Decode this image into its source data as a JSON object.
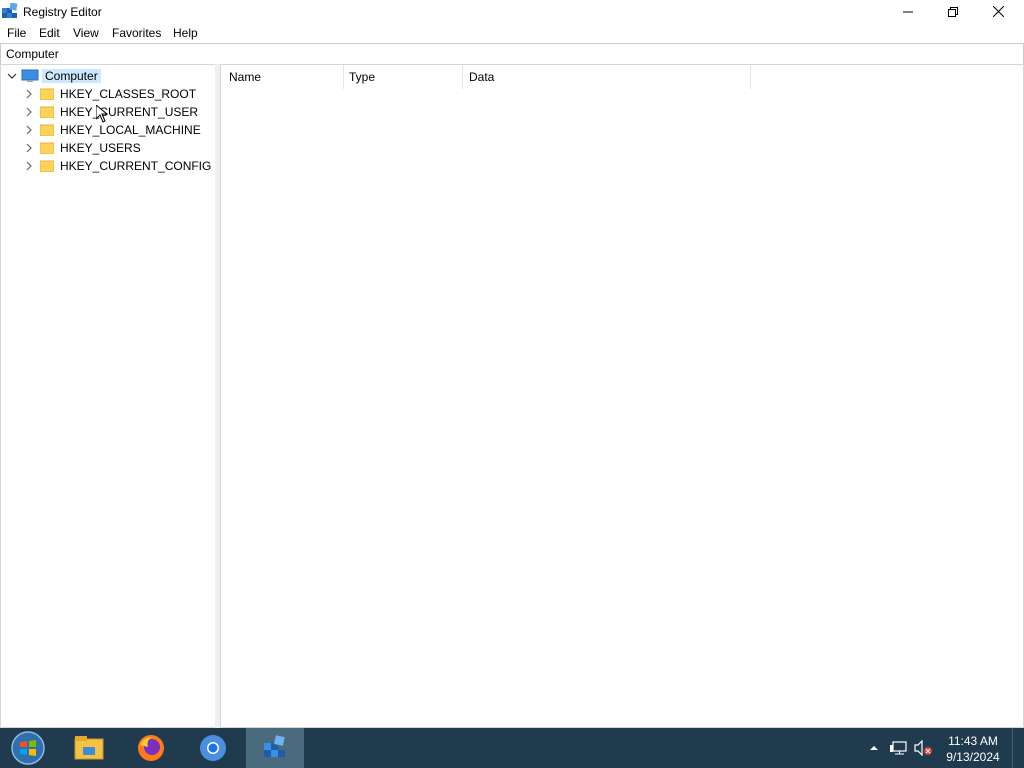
{
  "window": {
    "title": "Registry Editor",
    "controls": {
      "minimize_icon": "minimize-icon",
      "restore_icon": "restore-icon",
      "close_icon": "close-icon"
    }
  },
  "menu": {
    "items": [
      {
        "label": "File"
      },
      {
        "label": "Edit"
      },
      {
        "label": "View"
      },
      {
        "label": "Favorites"
      },
      {
        "label": "Help"
      }
    ]
  },
  "address": {
    "value": "Computer"
  },
  "tree": {
    "root": {
      "label": "Computer",
      "icon": "computer-icon",
      "expanded": true,
      "selected": true
    },
    "items": [
      {
        "label": "HKEY_CLASSES_ROOT",
        "icon": "folder-icon"
      },
      {
        "label": "HKEY_CURRENT_USER",
        "icon": "folder-icon"
      },
      {
        "label": "HKEY_LOCAL_MACHINE",
        "icon": "folder-icon"
      },
      {
        "label": "HKEY_USERS",
        "icon": "folder-icon"
      },
      {
        "label": "HKEY_CURRENT_CONFIG",
        "icon": "folder-icon"
      }
    ]
  },
  "list": {
    "columns": [
      {
        "label": "Name"
      },
      {
        "label": "Type"
      },
      {
        "label": "Data"
      }
    ]
  },
  "taskbar": {
    "start_icon": "windows-start-icon",
    "apps": [
      {
        "name": "file-explorer",
        "icon": "file-explorer-icon"
      },
      {
        "name": "firefox",
        "icon": "firefox-icon"
      },
      {
        "name": "chrome",
        "icon": "chrome-icon"
      },
      {
        "name": "registry-editor",
        "icon": "registry-editor-icon",
        "active": true
      }
    ],
    "tray": {
      "icons": [
        "show-hidden-icons-chevron",
        "network-icon",
        "volume-muted-icon"
      ],
      "time": "11:43 AM",
      "date": "9/13/2024"
    }
  },
  "colors": {
    "selection": "#cce8ff",
    "taskbar": "#1f3b4d",
    "taskbar_active": "#4a6a7d",
    "folder": "#ffd35a"
  }
}
